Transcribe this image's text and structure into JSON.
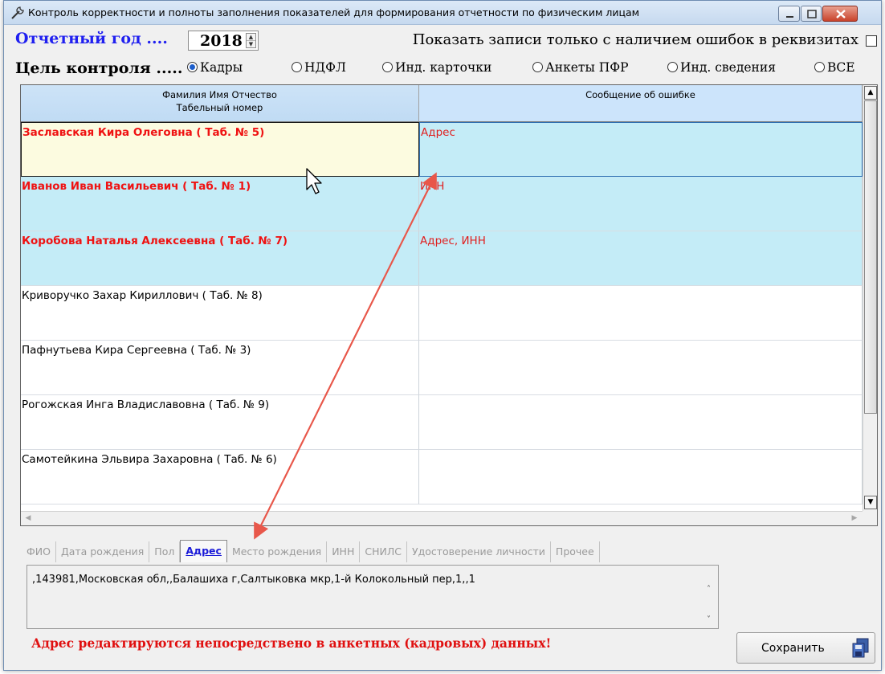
{
  "window": {
    "title": "Контроль корректности и полноты заполнения показателей для формирования отчетности по физическим лицам"
  },
  "year": {
    "label": "Отчетный год ....",
    "value": "2018"
  },
  "errors_only": {
    "label": "Показать записи только с наличием ошибок в реквизитах",
    "checked": false
  },
  "goal": {
    "label": "Цель контроля .....",
    "options": [
      {
        "label": "Кадры",
        "checked": true
      },
      {
        "label": "НДФЛ",
        "checked": false
      },
      {
        "label": "Инд. карточки",
        "checked": false
      },
      {
        "label": "Анкеты ПФР",
        "checked": false
      },
      {
        "label": "Инд. сведения",
        "checked": false
      },
      {
        "label": "ВСЕ",
        "checked": false
      }
    ]
  },
  "grid": {
    "columns": [
      {
        "line1": "Фамилия Имя Отчество",
        "line2": "Табельный номер"
      },
      {
        "line1": "Сообщение об ошибке",
        "line2": ""
      }
    ],
    "rows": [
      {
        "name": "Заславская Кира Олеговна ( Таб. № 5)",
        "error": "Адрес",
        "has_error": true,
        "selected": true
      },
      {
        "name": "Иванов Иван Васильевич ( Таб. № 1)",
        "error": "ИНН",
        "has_error": true,
        "selected": false
      },
      {
        "name": "Коробова Наталья Алексеевна ( Таб. № 7)",
        "error": "Адрес, ИНН",
        "has_error": true,
        "selected": false
      },
      {
        "name": "Криворучко Захар Кириллович ( Таб. № 8)",
        "error": "",
        "has_error": false,
        "selected": false
      },
      {
        "name": "Пафнутьева Кира Сергеевна ( Таб. № 3)",
        "error": "",
        "has_error": false,
        "selected": false
      },
      {
        "name": "Рогожская Инга Владиславовна ( Таб. № 9)",
        "error": "",
        "has_error": false,
        "selected": false
      },
      {
        "name": "Самотейкина Эльвира Захаровна ( Таб. № 6)",
        "error": "",
        "has_error": false,
        "selected": false
      }
    ]
  },
  "tabs": [
    {
      "label": "ФИО",
      "active": false
    },
    {
      "label": "Дата рождения",
      "active": false
    },
    {
      "label": "Пол",
      "active": false
    },
    {
      "label": "Адрес",
      "active": true
    },
    {
      "label": "Место рождения",
      "active": false
    },
    {
      "label": "ИНН",
      "active": false
    },
    {
      "label": "СНИЛС",
      "active": false
    },
    {
      "label": "Удостоверение личности",
      "active": false
    },
    {
      "label": "Прочее",
      "active": false
    }
  ],
  "address_text": ",143981,Московская обл,,Балашиха г,Салтыковка мкр,1-й Колокольный пер,1,,1",
  "warning": "Адрес редактируются непосредствено в анкетных (кадровых) данных!",
  "save_label": "Сохранить",
  "colors": {
    "error_text": "#ef1212",
    "error_row_bg": "#c4ecf7",
    "selected_cell_bg": "#fcfbe0",
    "accent_blue": "#1f1ff0",
    "annotation_arrow": "#e8574a"
  }
}
